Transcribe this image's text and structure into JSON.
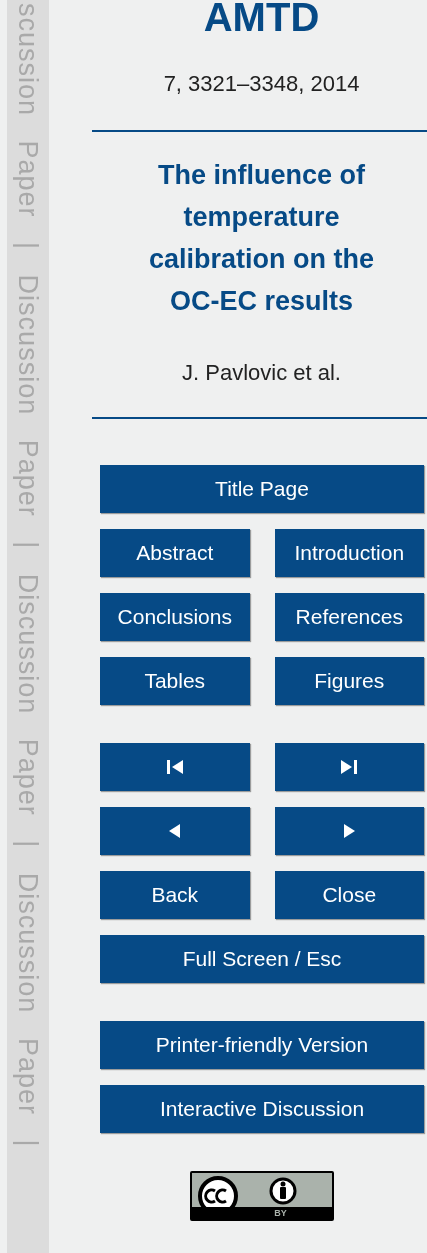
{
  "side_strip": {
    "text": "scussion Paper | Discussion Paper | Discussion Paper | Discussion Paper |"
  },
  "journal": "AMTD",
  "citation": "7, 3321–3348, 2014",
  "title": "The influence of temperature calibration on the OC-EC results",
  "authors": "J. Pavlovic et al.",
  "nav_groups": [
    [
      {
        "kind": "wide",
        "label": "Title Page"
      },
      {
        "kind": "half",
        "label": "Abstract"
      },
      {
        "kind": "half",
        "label": "Introduction"
      },
      {
        "kind": "half",
        "label": "Conclusions"
      },
      {
        "kind": "half",
        "label": "References"
      },
      {
        "kind": "half",
        "label": "Tables"
      },
      {
        "kind": "half",
        "label": "Figures"
      }
    ],
    [
      {
        "kind": "first"
      },
      {
        "kind": "last"
      },
      {
        "kind": "prev"
      },
      {
        "kind": "next"
      },
      {
        "kind": "half",
        "label": "Back"
      },
      {
        "kind": "half",
        "label": "Close"
      },
      {
        "kind": "wide",
        "label": "Full Screen / Esc"
      }
    ],
    [
      {
        "kind": "wide",
        "label": "Printer-friendly Version"
      },
      {
        "kind": "wide",
        "label": "Interactive Discussion"
      }
    ]
  ],
  "license_badge": {
    "label": "BY"
  }
}
